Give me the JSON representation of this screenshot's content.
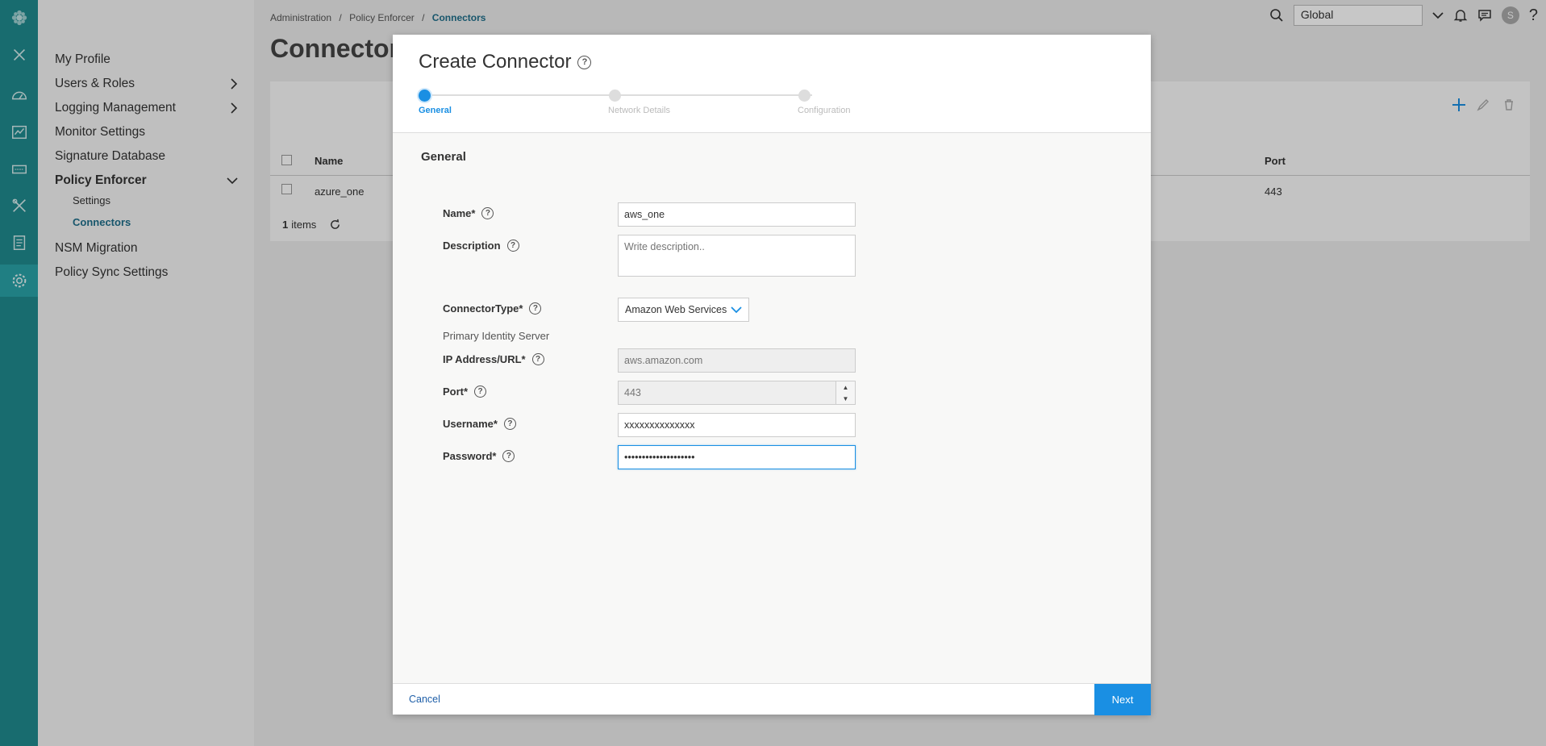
{
  "rail": {
    "icons": [
      "logo-icon",
      "close-icon",
      "dashboard-icon",
      "analytics-icon",
      "devices-icon",
      "tools-icon",
      "reports-icon",
      "settings-icon"
    ]
  },
  "sidenav": {
    "items": [
      {
        "label": "My Profile"
      },
      {
        "label": "Users & Roles"
      },
      {
        "label": "Logging Management"
      },
      {
        "label": "Monitor Settings"
      },
      {
        "label": "Signature Database"
      },
      {
        "label": "Policy Enforcer"
      },
      {
        "label": "NSM Migration"
      },
      {
        "label": "Policy Sync Settings"
      }
    ],
    "sub_items": [
      {
        "label": "Settings"
      },
      {
        "label": "Connectors"
      }
    ]
  },
  "breadcrumb": {
    "items": [
      "Administration",
      "Policy Enforcer",
      "Connectors"
    ],
    "sep": "/"
  },
  "page": {
    "title": "Connector"
  },
  "topbar": {
    "scope": "Global",
    "avatar": "S",
    "help": "?"
  },
  "table": {
    "headers": [
      "Name",
      "Port"
    ],
    "rows": [
      {
        "name": "azure_one",
        "port": "443"
      }
    ],
    "footer_count": "1",
    "footer_label": "items"
  },
  "modal": {
    "title": "Create Connector",
    "steps": [
      {
        "label": "General"
      },
      {
        "label": "Network Details"
      },
      {
        "label": "Configuration"
      }
    ],
    "section": "General",
    "fields": {
      "name_label": "Name*",
      "name_value": "aws_one",
      "description_label": "Description",
      "description_placeholder": "Write description..",
      "connector_type_label": "ConnectorType*",
      "connector_type_value": "Amazon Web Services",
      "primary_server_label": "Primary Identity Server",
      "ip_label": "IP Address/URL*",
      "ip_placeholder": "aws.amazon.com",
      "port_label": "Port*",
      "port_placeholder": "443",
      "username_label": "Username*",
      "username_value": "xxxxxxxxxxxxxx",
      "password_label": "Password*",
      "password_value": "••••••••••••••••••••"
    },
    "footer": {
      "cancel": "Cancel",
      "next": "Next"
    }
  }
}
